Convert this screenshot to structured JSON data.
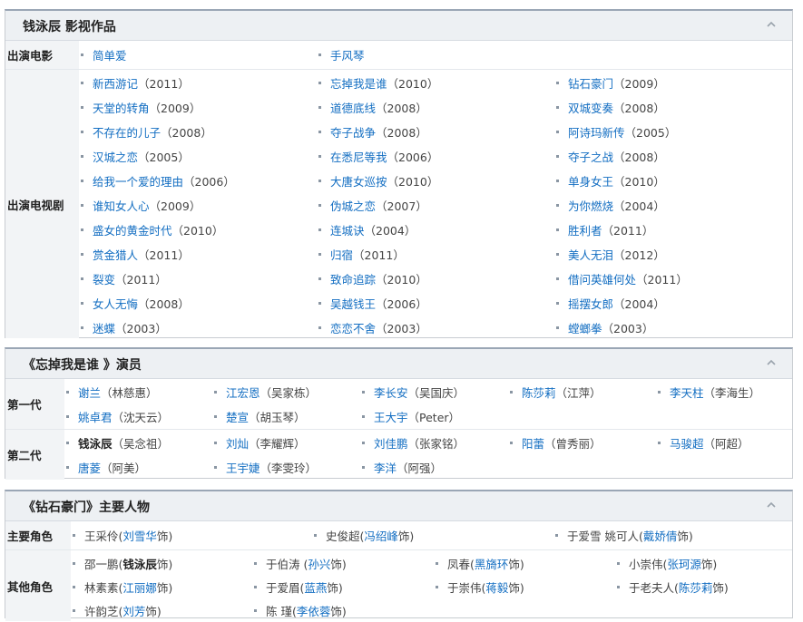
{
  "box1": {
    "title": "钱泳辰 影视作品",
    "groups": [
      {
        "label": "出演电影",
        "items": [
          {
            "link": "简单爱",
            "rest": ""
          },
          {
            "link": "手风琴",
            "rest": ""
          }
        ]
      },
      {
        "label": "出演电视剧",
        "items": [
          {
            "link": "新西游记",
            "rest": "（2011）"
          },
          {
            "link": "忘掉我是谁",
            "rest": "（2010）"
          },
          {
            "link": "钻石豪门",
            "rest": "（2009）"
          },
          {
            "link": "天堂的转角",
            "rest": "（2009）"
          },
          {
            "link": "道德底线",
            "rest": "（2008）"
          },
          {
            "link": "双城变奏",
            "rest": "（2008）"
          },
          {
            "link": "不存在的儿子",
            "rest": "（2008）"
          },
          {
            "link": "夺子战争",
            "rest": "（2008）"
          },
          {
            "link": "阿诗玛新传",
            "rest": "（2005）"
          },
          {
            "link": "汉城之恋",
            "rest": "（2005）"
          },
          {
            "link": "在悉尼等我",
            "rest": "（2006）"
          },
          {
            "link": "夺子之战",
            "rest": "（2008）"
          },
          {
            "link": "给我一个爱的理由",
            "rest": "（2006）"
          },
          {
            "link": "大唐女巡按",
            "rest": "（2010）"
          },
          {
            "link": "单身女王",
            "rest": "（2010）"
          },
          {
            "link": "谁知女人心",
            "rest": "（2009）"
          },
          {
            "link": "伪城之恋",
            "rest": "（2007）"
          },
          {
            "link": "为你燃烧",
            "rest": "（2004）"
          },
          {
            "link": "盛女的黄金时代",
            "rest": "（2010）"
          },
          {
            "link": "连城诀",
            "rest": "（2004）"
          },
          {
            "link": "胜利者",
            "rest": "（2011）"
          },
          {
            "link": "赏金猎人",
            "rest": "（2011）"
          },
          {
            "link": "归宿",
            "rest": "（2011）"
          },
          {
            "link": "美人无泪",
            "rest": "（2012）"
          },
          {
            "link": "裂变",
            "rest": "（2011）"
          },
          {
            "link": "致命追踪",
            "rest": "（2010）"
          },
          {
            "link": "借问英雄何处",
            "rest": "（2011）"
          },
          {
            "link": "女人无悔",
            "rest": "（2008）"
          },
          {
            "link": "吴越钱王",
            "rest": "（2006）"
          },
          {
            "link": "摇摆女郎",
            "rest": "（2004）"
          },
          {
            "link": "迷蝶",
            "rest": "（2003）"
          },
          {
            "link": "恋恋不舍",
            "rest": "（2003）"
          },
          {
            "link": "螳螂拳",
            "rest": "（2003）"
          }
        ]
      }
    ]
  },
  "box2": {
    "title": "《忘掉我是谁 》演员",
    "groups": [
      {
        "label": "第一代",
        "items": [
          {
            "link": "谢兰",
            "rest": "（林慈惠）"
          },
          {
            "link": "江宏恩",
            "rest": "（吴家栋）"
          },
          {
            "link": "李长安",
            "rest": "（吴国庆）"
          },
          {
            "link": "陈莎莉",
            "rest": "（江萍）"
          },
          {
            "link": "李天柱",
            "rest": "（李海生）"
          },
          {
            "link": "姚卓君",
            "rest": "（沈天云）"
          },
          {
            "link": "楚宣",
            "rest": "（胡玉琴）"
          },
          {
            "link": "王大宇",
            "rest": "（Peter）"
          }
        ]
      },
      {
        "label": "第二代",
        "items": [
          {
            "bold": "钱泳辰",
            "rest": "（吴念祖）"
          },
          {
            "link": "刘灿",
            "rest": "（李耀辉）"
          },
          {
            "link": "刘佳鹏",
            "rest": "（张家铭）"
          },
          {
            "link": "阳蕾",
            "rest": "（曾秀丽）"
          },
          {
            "link": "马骏超",
            "rest": "（阿超）"
          },
          {
            "link": "唐菱",
            "rest": "（阿美）"
          },
          {
            "link": "王宇婕",
            "rest": "（李雯玲）"
          },
          {
            "link": "李洋",
            "rest": "（阿强）"
          }
        ]
      }
    ]
  },
  "box3": {
    "title": "《钻石豪门》主要人物",
    "groups": [
      {
        "label": "主要角色",
        "items": [
          {
            "pre": "王采伶(",
            "link": "刘雪华",
            "rest": " 饰)"
          },
          {
            "pre": "史俊超(",
            "link": "冯绍峰",
            "rest": " 饰)"
          },
          {
            "pre": "于爱雪 姚可人(",
            "link": "戴娇倩",
            "rest": " 饰)"
          }
        ]
      },
      {
        "label": "其他角色",
        "items": [
          {
            "pre": "邵一鹏(",
            "bold": "钱泳辰",
            "rest": " 饰)"
          },
          {
            "pre": "于伯涛 (",
            "link": "孙兴",
            "rest": " 饰)"
          },
          {
            "pre": "凤春(",
            "link": "黑旖环",
            "rest": " 饰)"
          },
          {
            "pre": "小崇伟(",
            "link": "张珂源",
            "rest": " 饰)"
          },
          {
            "pre": "林素素(",
            "link": "江丽娜",
            "rest": " 饰)"
          },
          {
            "pre": "于爱眉(",
            "link": "蓝燕",
            "rest": " 饰)"
          },
          {
            "pre": "于崇伟(",
            "link": "蒋毅",
            "rest": " 饰)"
          },
          {
            "pre": "于老夫人(",
            "link": "陈莎莉",
            "rest": " 饰)"
          },
          {
            "pre": "许韵芝(",
            "link": "刘芳",
            "rest": " 饰)"
          },
          {
            "pre": "陈 瑾(",
            "link": "李依蓉",
            "rest": " 饰)"
          }
        ]
      }
    ]
  },
  "colors": {
    "link": "#136ec2",
    "header_bg": "#edf0f3",
    "label_bg": "#f2f4f6"
  },
  "icons": {
    "collapse": "chevron-up-icon",
    "bullet": "square-bullet-icon"
  }
}
